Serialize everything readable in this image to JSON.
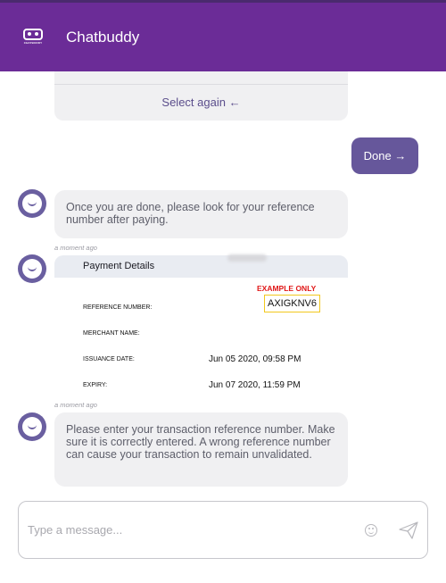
{
  "header": {
    "logo_text": "CHATBUDDY",
    "title": "Chatbuddy"
  },
  "chat": {
    "select_again": "Select again ←",
    "done_button": "Done →",
    "messages": [
      {
        "text": "Once you are done, please look for your reference number after paying.",
        "time": "a moment ago"
      },
      {
        "time": "a moment ago"
      },
      {
        "text": "Please enter your transaction reference number. Make sure it is correctly entered. A wrong reference number can cause your transaction to remain unvalidated."
      }
    ],
    "payment": {
      "title": "Payment Details",
      "example_note": "EXAMPLE ONLY",
      "reference_label": "REFERENCE NUMBER:",
      "reference_value": "AXIGKNV6",
      "merchant_label": "MERCHANT NAME:",
      "issuance_label": "ISSUANCE DATE:",
      "issuance_value": "Jun 05 2020, 09:58 PM",
      "expiry_label": "EXPIRY:",
      "expiry_value": "Jun 07 2020, 11:59 PM"
    }
  },
  "composer": {
    "placeholder": "Type a message..."
  },
  "colors": {
    "header": "#6b2c97",
    "accent": "#66579b",
    "bubble": "#f0f0f2",
    "avatar": "#6a5fa0",
    "example_red": "#e01818",
    "ref_border": "#f2c81e"
  },
  "icons": [
    "chatbuddy-logo-icon",
    "bot-avatar-icon",
    "emoji-icon",
    "send-icon"
  ]
}
